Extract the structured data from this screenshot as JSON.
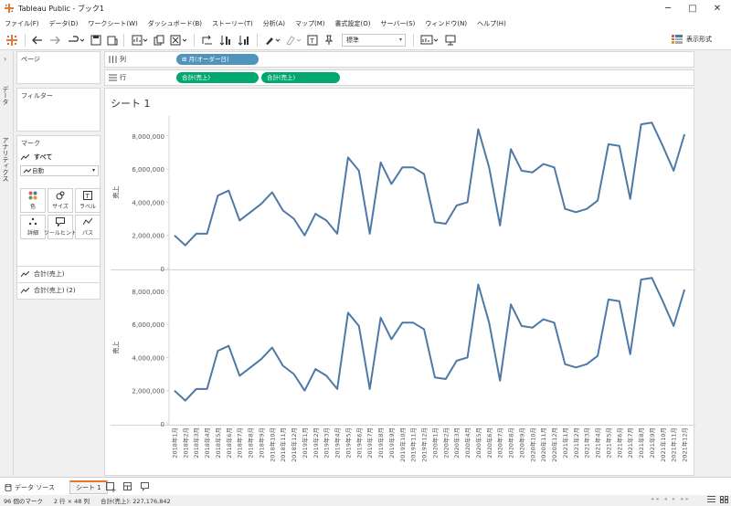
{
  "window": {
    "title": "Tableau Public - ブック1",
    "minimize": "─",
    "maximize": "□",
    "close": "✕"
  },
  "menu": [
    "ファイル(F)",
    "データ(D)",
    "ワークシート(W)",
    "ダッシュボード(B)",
    "ストーリー(T)",
    "分析(A)",
    "マップ(M)",
    "書式設定(O)",
    "サーバー(S)",
    "ウィンドウ(N)",
    "ヘルプ(H)"
  ],
  "toolbar": {
    "fit": "標準",
    "show_me": "表示形式"
  },
  "rail": {
    "data": "データ",
    "analytics": "アナリティクス"
  },
  "panes": {
    "pages": "ページ",
    "filters": "フィルター",
    "marks": "マーク"
  },
  "marks": {
    "all": "すべて",
    "type": "自動",
    "cards": [
      "色",
      "サイズ",
      "ラベル",
      "詳細",
      "ツールヒント",
      "パス"
    ],
    "measures": [
      "合計(売上)",
      "合計(売上) (2)"
    ]
  },
  "shelves": {
    "columns_label": "列",
    "rows_label": "行",
    "columns_pill": "⊞ 月(オーダー日)",
    "rows_pills": [
      "合計(売上)",
      "合計(売上)"
    ],
    "colors": {
      "dimension": "#4e94bd",
      "measure": "#00a870"
    }
  },
  "sheet": {
    "title": "シート 1"
  },
  "chart_data": [
    {
      "type": "line",
      "ylabel": "売上",
      "ylim": [
        0,
        9200000
      ],
      "yticks": [
        "0",
        "2,000,000",
        "4,000,000",
        "6,000,000",
        "8,000,000"
      ],
      "grid": false,
      "color": "#4e79a7",
      "x": [
        "2018年1月",
        "2018年2月",
        "2018年3月",
        "2018年4月",
        "2018年5月",
        "2018年6月",
        "2018年7月",
        "2018年8月",
        "2018年9月",
        "2018年10月",
        "2018年11月",
        "2018年12月",
        "2019年1月",
        "2019年2月",
        "2019年3月",
        "2019年4月",
        "2019年5月",
        "2019年6月",
        "2019年7月",
        "2019年8月",
        "2019年9月",
        "2019年10月",
        "2019年11月",
        "2019年12月",
        "2020年1月",
        "2020年2月",
        "2020年3月",
        "2020年4月",
        "2020年5月",
        "2020年6月",
        "2020年7月",
        "2020年8月",
        "2020年9月",
        "2020年10月",
        "2020年11月",
        "2020年12月",
        "2021年1月",
        "2021年2月",
        "2021年3月",
        "2021年4月",
        "2021年5月",
        "2021年6月",
        "2021年7月",
        "2021年8月",
        "2021年9月",
        "2021年10月",
        "2021年11月",
        "2021年12月"
      ],
      "values": [
        2000000,
        1400000,
        2100000,
        2100000,
        4400000,
        4700000,
        2900000,
        3400000,
        3900000,
        4600000,
        3500000,
        3000000,
        2000000,
        3300000,
        2900000,
        2100000,
        6700000,
        5900000,
        2100000,
        6400000,
        5100000,
        6100000,
        6100000,
        5700000,
        2800000,
        2700000,
        3800000,
        4000000,
        8400000,
        6100000,
        2600000,
        7200000,
        5900000,
        5800000,
        6300000,
        6100000,
        3600000,
        3400000,
        3600000,
        4100000,
        7500000,
        7400000,
        4200000,
        8700000,
        8800000,
        7400000,
        5900000,
        8100000
      ]
    },
    {
      "type": "line",
      "ylabel": "売上",
      "ylim": [
        0,
        9200000
      ],
      "yticks": [
        "0",
        "2,000,000",
        "4,000,000",
        "6,000,000",
        "8,000,000"
      ],
      "grid": false,
      "color": "#4e79a7",
      "x": [
        "2018年1月",
        "2018年2月",
        "2018年3月",
        "2018年4月",
        "2018年5月",
        "2018年6月",
        "2018年7月",
        "2018年8月",
        "2018年9月",
        "2018年10月",
        "2018年11月",
        "2018年12月",
        "2019年1月",
        "2019年2月",
        "2019年3月",
        "2019年4月",
        "2019年5月",
        "2019年6月",
        "2019年7月",
        "2019年8月",
        "2019年9月",
        "2019年10月",
        "2019年11月",
        "2019年12月",
        "2020年1月",
        "2020年2月",
        "2020年3月",
        "2020年4月",
        "2020年5月",
        "2020年6月",
        "2020年7月",
        "2020年8月",
        "2020年9月",
        "2020年10月",
        "2020年11月",
        "2020年12月",
        "2021年1月",
        "2021年2月",
        "2021年3月",
        "2021年4月",
        "2021年5月",
        "2021年6月",
        "2021年7月",
        "2021年8月",
        "2021年9月",
        "2021年10月",
        "2021年11月",
        "2021年12月"
      ],
      "values": [
        2000000,
        1400000,
        2100000,
        2100000,
        4400000,
        4700000,
        2900000,
        3400000,
        3900000,
        4600000,
        3500000,
        3000000,
        2000000,
        3300000,
        2900000,
        2100000,
        6700000,
        5900000,
        2100000,
        6400000,
        5100000,
        6100000,
        6100000,
        5700000,
        2800000,
        2700000,
        3800000,
        4000000,
        8400000,
        6100000,
        2600000,
        7200000,
        5900000,
        5800000,
        6300000,
        6100000,
        3600000,
        3400000,
        3600000,
        4100000,
        7500000,
        7400000,
        4200000,
        8700000,
        8800000,
        7400000,
        5900000,
        8100000
      ]
    }
  ],
  "tabs": {
    "datasource": "データ ソース",
    "sheet1": "シート 1"
  },
  "status": {
    "marks": "96 個のマーク",
    "rows_cols": "2 行 × 48 列",
    "sum": "合計(売上): 227,176,842"
  }
}
